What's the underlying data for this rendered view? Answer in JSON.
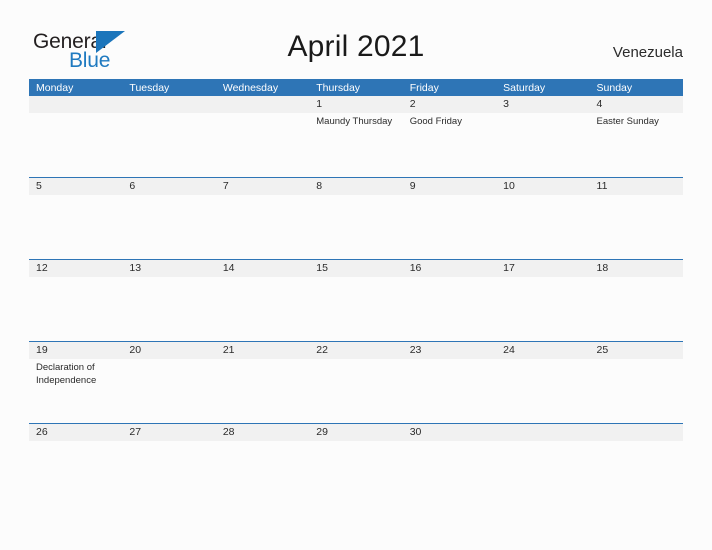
{
  "brand": {
    "name_part1": "General",
    "name_part2": "Blue",
    "triangle_icon": "blue-triangle-icon",
    "color_dark": "#231f20",
    "color_blue": "#1b75bb"
  },
  "header": {
    "title": "April 2021",
    "country": "Venezuela"
  },
  "theme": {
    "header_blue": "#2e75b6",
    "day_band_gray": "#f1f1f1",
    "page_background": "#fcfcfc",
    "text_color": "#2b2b2b"
  },
  "calendar": {
    "weekdays": [
      "Monday",
      "Tuesday",
      "Wednesday",
      "Thursday",
      "Friday",
      "Saturday",
      "Sunday"
    ],
    "weeks": [
      [
        {
          "date": "",
          "events": []
        },
        {
          "date": "",
          "events": []
        },
        {
          "date": "",
          "events": []
        },
        {
          "date": "1",
          "events": [
            "Maundy Thursday"
          ]
        },
        {
          "date": "2",
          "events": [
            "Good Friday"
          ]
        },
        {
          "date": "3",
          "events": []
        },
        {
          "date": "4",
          "events": [
            "Easter Sunday"
          ]
        }
      ],
      [
        {
          "date": "5",
          "events": []
        },
        {
          "date": "6",
          "events": []
        },
        {
          "date": "7",
          "events": []
        },
        {
          "date": "8",
          "events": []
        },
        {
          "date": "9",
          "events": []
        },
        {
          "date": "10",
          "events": []
        },
        {
          "date": "11",
          "events": []
        }
      ],
      [
        {
          "date": "12",
          "events": []
        },
        {
          "date": "13",
          "events": []
        },
        {
          "date": "14",
          "events": []
        },
        {
          "date": "15",
          "events": []
        },
        {
          "date": "16",
          "events": []
        },
        {
          "date": "17",
          "events": []
        },
        {
          "date": "18",
          "events": []
        }
      ],
      [
        {
          "date": "19",
          "events": [
            "Declaration of",
            "Independence"
          ]
        },
        {
          "date": "20",
          "events": []
        },
        {
          "date": "21",
          "events": []
        },
        {
          "date": "22",
          "events": []
        },
        {
          "date": "23",
          "events": []
        },
        {
          "date": "24",
          "events": []
        },
        {
          "date": "25",
          "events": []
        }
      ],
      [
        {
          "date": "26",
          "events": []
        },
        {
          "date": "27",
          "events": []
        },
        {
          "date": "28",
          "events": []
        },
        {
          "date": "29",
          "events": []
        },
        {
          "date": "30",
          "events": []
        },
        {
          "date": "",
          "events": []
        },
        {
          "date": "",
          "events": []
        }
      ]
    ]
  }
}
